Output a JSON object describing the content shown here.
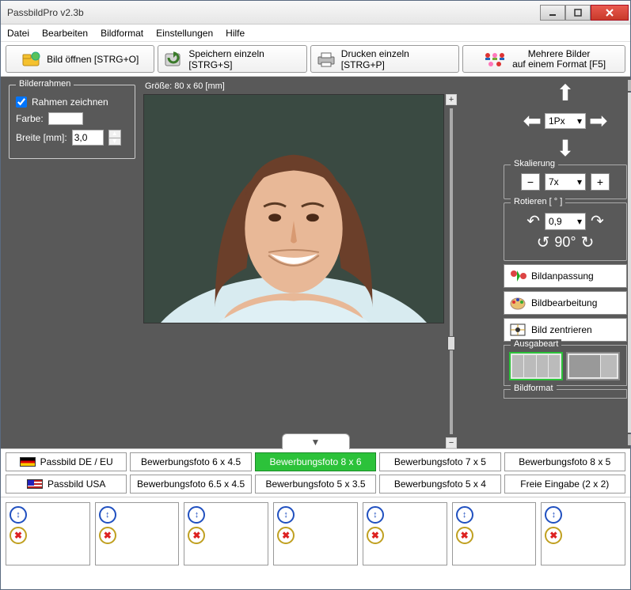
{
  "window": {
    "title": "PassbildPro  v2.3b"
  },
  "menu": [
    "Datei",
    "Bearbeiten",
    "Bildformat",
    "Einstellungen",
    "Hilfe"
  ],
  "toolbar": {
    "open": "Bild öffnen [STRG+O]",
    "save": "Speichern einzeln [STRG+S]",
    "print": "Drucken einzeln [STRG+P]",
    "multi_l1": "Mehrere Bilder",
    "multi_l2": "auf einem Format [F5]"
  },
  "frame": {
    "legend": "Bilderrahmen",
    "draw_label": "Rahmen zeichnen",
    "draw_checked": true,
    "color_label": "Farbe:",
    "width_label": "Breite [mm]:",
    "width_value": "3,0"
  },
  "canvas": {
    "size_label": "Größe: 80 x 60 [mm]",
    "zoom_plus": "+",
    "zoom_minus": "−"
  },
  "move": {
    "px_value": "1Px"
  },
  "scale": {
    "legend": "Skalierung",
    "minus": "−",
    "value": "7x",
    "plus": "+"
  },
  "rotate": {
    "legend": "Rotieren [ ° ]",
    "value": "0,9",
    "deg": "90°"
  },
  "actions": {
    "fit": "Bildanpassung",
    "edit": "Bildbearbeitung",
    "center": "Bild zentrieren"
  },
  "output": {
    "legend": "Ausgabeart"
  },
  "bildformat_legend": "Bildformat",
  "formats": {
    "r1": [
      "Passbild DE / EU",
      "Bewerbungsfoto 6 x 4.5",
      "Bewerbungsfoto 8 x 6",
      "Bewerbungsfoto 7 x 5",
      "Bewerbungsfoto 8 x 5"
    ],
    "r2": [
      "Passbild USA",
      "Bewerbungsfoto 6.5 x 4.5",
      "Bewerbungsfoto 5 x 3.5",
      "Bewerbungsfoto 5 x 4",
      "Freie Eingabe (2 x 2)"
    ],
    "active_index": 2
  },
  "tray_toggle": "▼",
  "slot_icons": {
    "step": "↕",
    "remove": "✖"
  }
}
